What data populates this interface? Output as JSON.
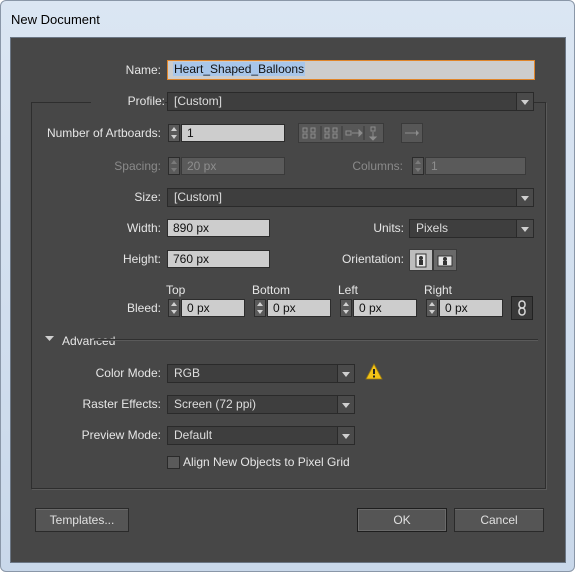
{
  "window": {
    "title": "New Document"
  },
  "form": {
    "name": {
      "label": "Name:",
      "value": "Heart_Shaped_Balloons"
    },
    "profile": {
      "label": "Profile:",
      "value": "[Custom]"
    },
    "artboards": {
      "label": "Number of Artboards:",
      "value": "1"
    },
    "spacing": {
      "label": "Spacing:",
      "value": "20 px"
    },
    "columns": {
      "label": "Columns:",
      "value": "1"
    },
    "size": {
      "label": "Size:",
      "value": "[Custom]"
    },
    "width": {
      "label": "Width:",
      "value": "890 px"
    },
    "units": {
      "label": "Units:",
      "value": "Pixels"
    },
    "height": {
      "label": "Height:",
      "value": "760 px"
    },
    "orientation": {
      "label": "Orientation:"
    },
    "bleed": {
      "label": "Bleed:",
      "top": {
        "label": "Top",
        "value": "0 px"
      },
      "bottom": {
        "label": "Bottom",
        "value": "0 px"
      },
      "left": {
        "label": "Left",
        "value": "0 px"
      },
      "right": {
        "label": "Right",
        "value": "0 px"
      }
    },
    "advanced": {
      "label": "Advanced"
    },
    "color_mode": {
      "label": "Color Mode:",
      "value": "RGB"
    },
    "raster_effects": {
      "label": "Raster Effects:",
      "value": "Screen (72 ppi)"
    },
    "preview_mode": {
      "label": "Preview Mode:",
      "value": "Default"
    },
    "align_pixel_grid": {
      "label": "Align New Objects to Pixel Grid",
      "checked": false
    }
  },
  "buttons": {
    "templates": "Templates...",
    "ok": "OK",
    "cancel": "Cancel"
  },
  "colors": {
    "dialog_bg": "#474747",
    "field_bg": "#cdcdcd",
    "name_focus": "#e0852a",
    "warning": "#f3c317"
  },
  "icons": [
    "arrange-grid-by-row-icon",
    "arrange-grid-by-column-icon",
    "arrange-by-row-icon",
    "arrange-by-column-icon",
    "change-layout-arrow-icon",
    "portrait-icon",
    "landscape-icon",
    "link-icon",
    "warning-icon",
    "disclosure-triangle-icon"
  ]
}
